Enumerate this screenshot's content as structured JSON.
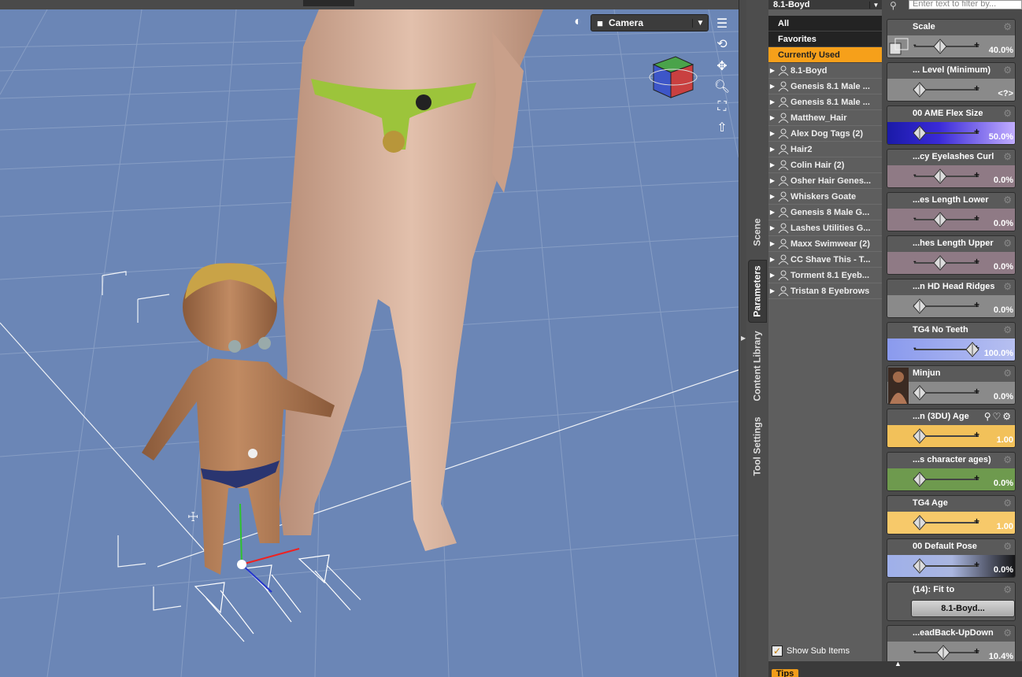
{
  "viewport": {
    "camera_label": "Camera"
  },
  "side_tabs": [
    {
      "label": "Scene"
    },
    {
      "label": "Parameters"
    },
    {
      "label": "Content Library"
    },
    {
      "label": "Tool Settings"
    }
  ],
  "node_panel": {
    "selected_node": "8.1-Boyd",
    "filters": [
      "All",
      "Favorites",
      "Currently Used"
    ],
    "items": [
      "8.1-Boyd",
      "Genesis 8.1 Male ...",
      "Genesis 8.1 Male ...",
      "Matthew_Hair",
      "Alex Dog Tags (2)",
      "Hair2",
      "Colin Hair (2)",
      "Osher Hair Genes...",
      "Whiskers Goate",
      "Genesis 8 Male G...",
      "Lashes Utilities G...",
      "Maxx Swimwear (2)",
      "CC Shave This - T...",
      "Torment 8.1 Eyeb...",
      "Tristan 8 Eyebrows"
    ],
    "show_sub_items_label": "Show Sub Items",
    "show_sub_items_checked": true
  },
  "params_panel": {
    "search_placeholder": "Enter text to filter by...",
    "cards": [
      {
        "title": "Scale",
        "value": "40.0%",
        "pos": 0.4,
        "bg": "#8a8a8a",
        "thumb": "scale"
      },
      {
        "title": "... Level (Minimum)",
        "value": "<?>",
        "pos": 0.08,
        "bg": "#8a8a8a"
      },
      {
        "title": "00 AME Flex Size",
        "value": "50.0%",
        "pos": 0.08,
        "bg": "flex"
      },
      {
        "title": "...cy Eyelashes Curl",
        "value": "0.0%",
        "pos": 0.4,
        "bg": "#8f7a85"
      },
      {
        "title": "...es Length Lower",
        "value": "0.0%",
        "pos": 0.4,
        "bg": "#8f7a85"
      },
      {
        "title": "...hes Length Upper",
        "value": "0.0%",
        "pos": 0.4,
        "bg": "#8f7a85"
      },
      {
        "title": "...n HD Head Ridges",
        "value": "0.0%",
        "pos": 0.08,
        "bg": "#8a8a8a"
      },
      {
        "title": "TG4 No Teeth",
        "value": "100.0%",
        "pos": 0.9,
        "bg": "blue"
      },
      {
        "title": "Minjun",
        "value": "0.0%",
        "pos": 0.08,
        "bg": "#8a8a8a",
        "thumb": "portrait"
      },
      {
        "title": "...n (3DU) Age",
        "value": "1.00",
        "pos": 0.08,
        "bg": "#f2c15a",
        "extra_icons": true
      },
      {
        "title": "...s character ages)",
        "value": "0.0%",
        "pos": 0.08,
        "bg": "#6e9a4e"
      },
      {
        "title": "TG4 Age",
        "value": "1.00",
        "pos": 0.08,
        "bg": "#f7c96a"
      },
      {
        "title": "00 Default Pose",
        "value": "0.0%",
        "pos": 0.08,
        "bg": "bluedark"
      },
      {
        "title": "(14): Fit to",
        "button": "8.1-Boyd...",
        "bg": "none"
      },
      {
        "title": "...eadBack-UpDown",
        "value": "10.4%",
        "pos": 0.45,
        "bg": "#8a8a8a"
      }
    ]
  },
  "tips_label": "Tips"
}
